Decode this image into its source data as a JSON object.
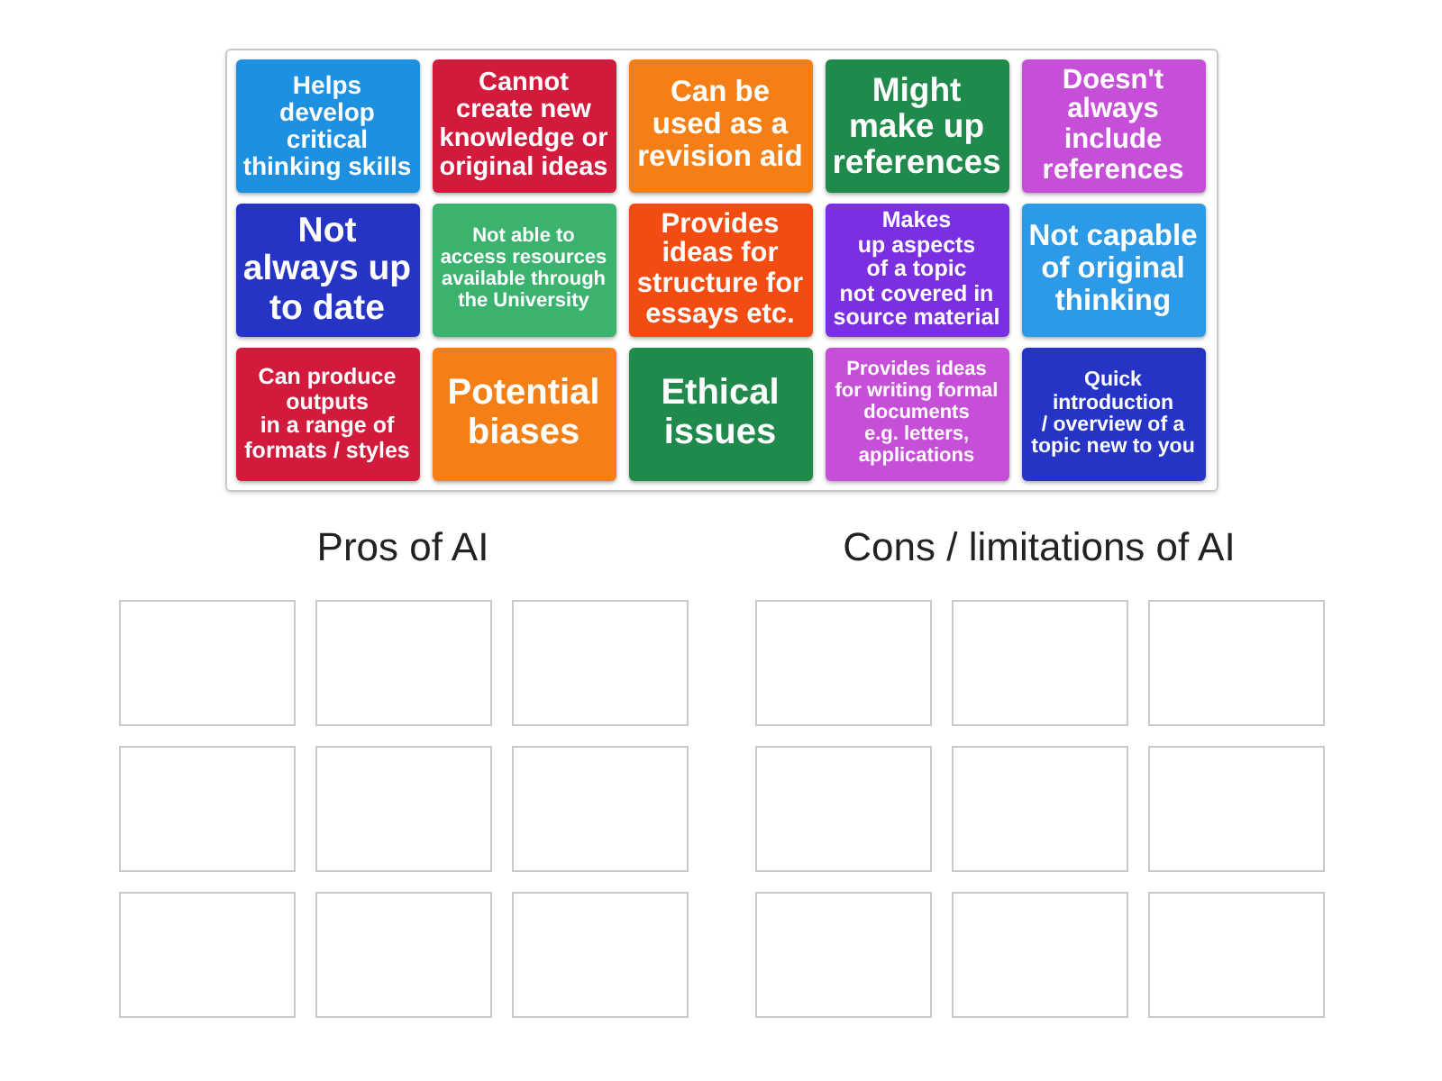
{
  "tiles": [
    {
      "text": "Helps\ndevelop\ncritical\nthinking skills",
      "color": "#1e90e0"
    },
    {
      "text": "Cannot\ncreate new\nknowledge or\noriginal ideas",
      "color": "#d21a3c"
    },
    {
      "text": "Can be\nused as a\nrevision aid",
      "color": "#f57f17"
    },
    {
      "text": "Might\nmake up\nreferences",
      "color": "#1f8a4c"
    },
    {
      "text": "Doesn't\nalways\ninclude\nreferences",
      "color": "#c64fd8"
    },
    {
      "text": "Not\nalways up\nto date",
      "color": "#2634c6"
    },
    {
      "text": "Not able to\naccess resources\navailable through\nthe University",
      "color": "#3bb36f"
    },
    {
      "text": "Provides\nideas for\nstructure for\nessays etc.",
      "color": "#f24c12"
    },
    {
      "text": "Makes\nup aspects\nof a topic\nnot covered in\nsource material",
      "color": "#7a2fe0"
    },
    {
      "text": "Not capable\nof original\nthinking",
      "color": "#2c9ae6"
    },
    {
      "text": "Can produce\noutputs\nin a range of\nformats / styles",
      "color": "#d21a3c"
    },
    {
      "text": "Potential\nbiases",
      "color": "#f57f17"
    },
    {
      "text": "Ethical\nissues",
      "color": "#1f8a4c"
    },
    {
      "text": "Provides ideas\nfor writing formal\ndocuments\ne.g. letters,\napplications",
      "color": "#c64fd8"
    },
    {
      "text": "Quick\nintroduction\n/ overview of a\ntopic new to you",
      "color": "#2634c6"
    }
  ],
  "groups": [
    {
      "title": "Pros of AI",
      "slots": [
        {
          "filled": false
        },
        {
          "filled": false
        },
        {
          "filled": false
        },
        {
          "filled": false
        },
        {
          "filled": false
        },
        {
          "filled": false
        },
        {
          "filled": false
        },
        {
          "filled": false
        },
        {
          "filled": false
        }
      ]
    },
    {
      "title": "Cons / limitations of AI",
      "slots": [
        {
          "filled": false
        },
        {
          "filled": false
        },
        {
          "filled": false
        },
        {
          "filled": false
        },
        {
          "filled": false
        },
        {
          "filled": false
        },
        {
          "filled": false
        },
        {
          "filled": false
        },
        {
          "filled": false
        }
      ]
    }
  ]
}
